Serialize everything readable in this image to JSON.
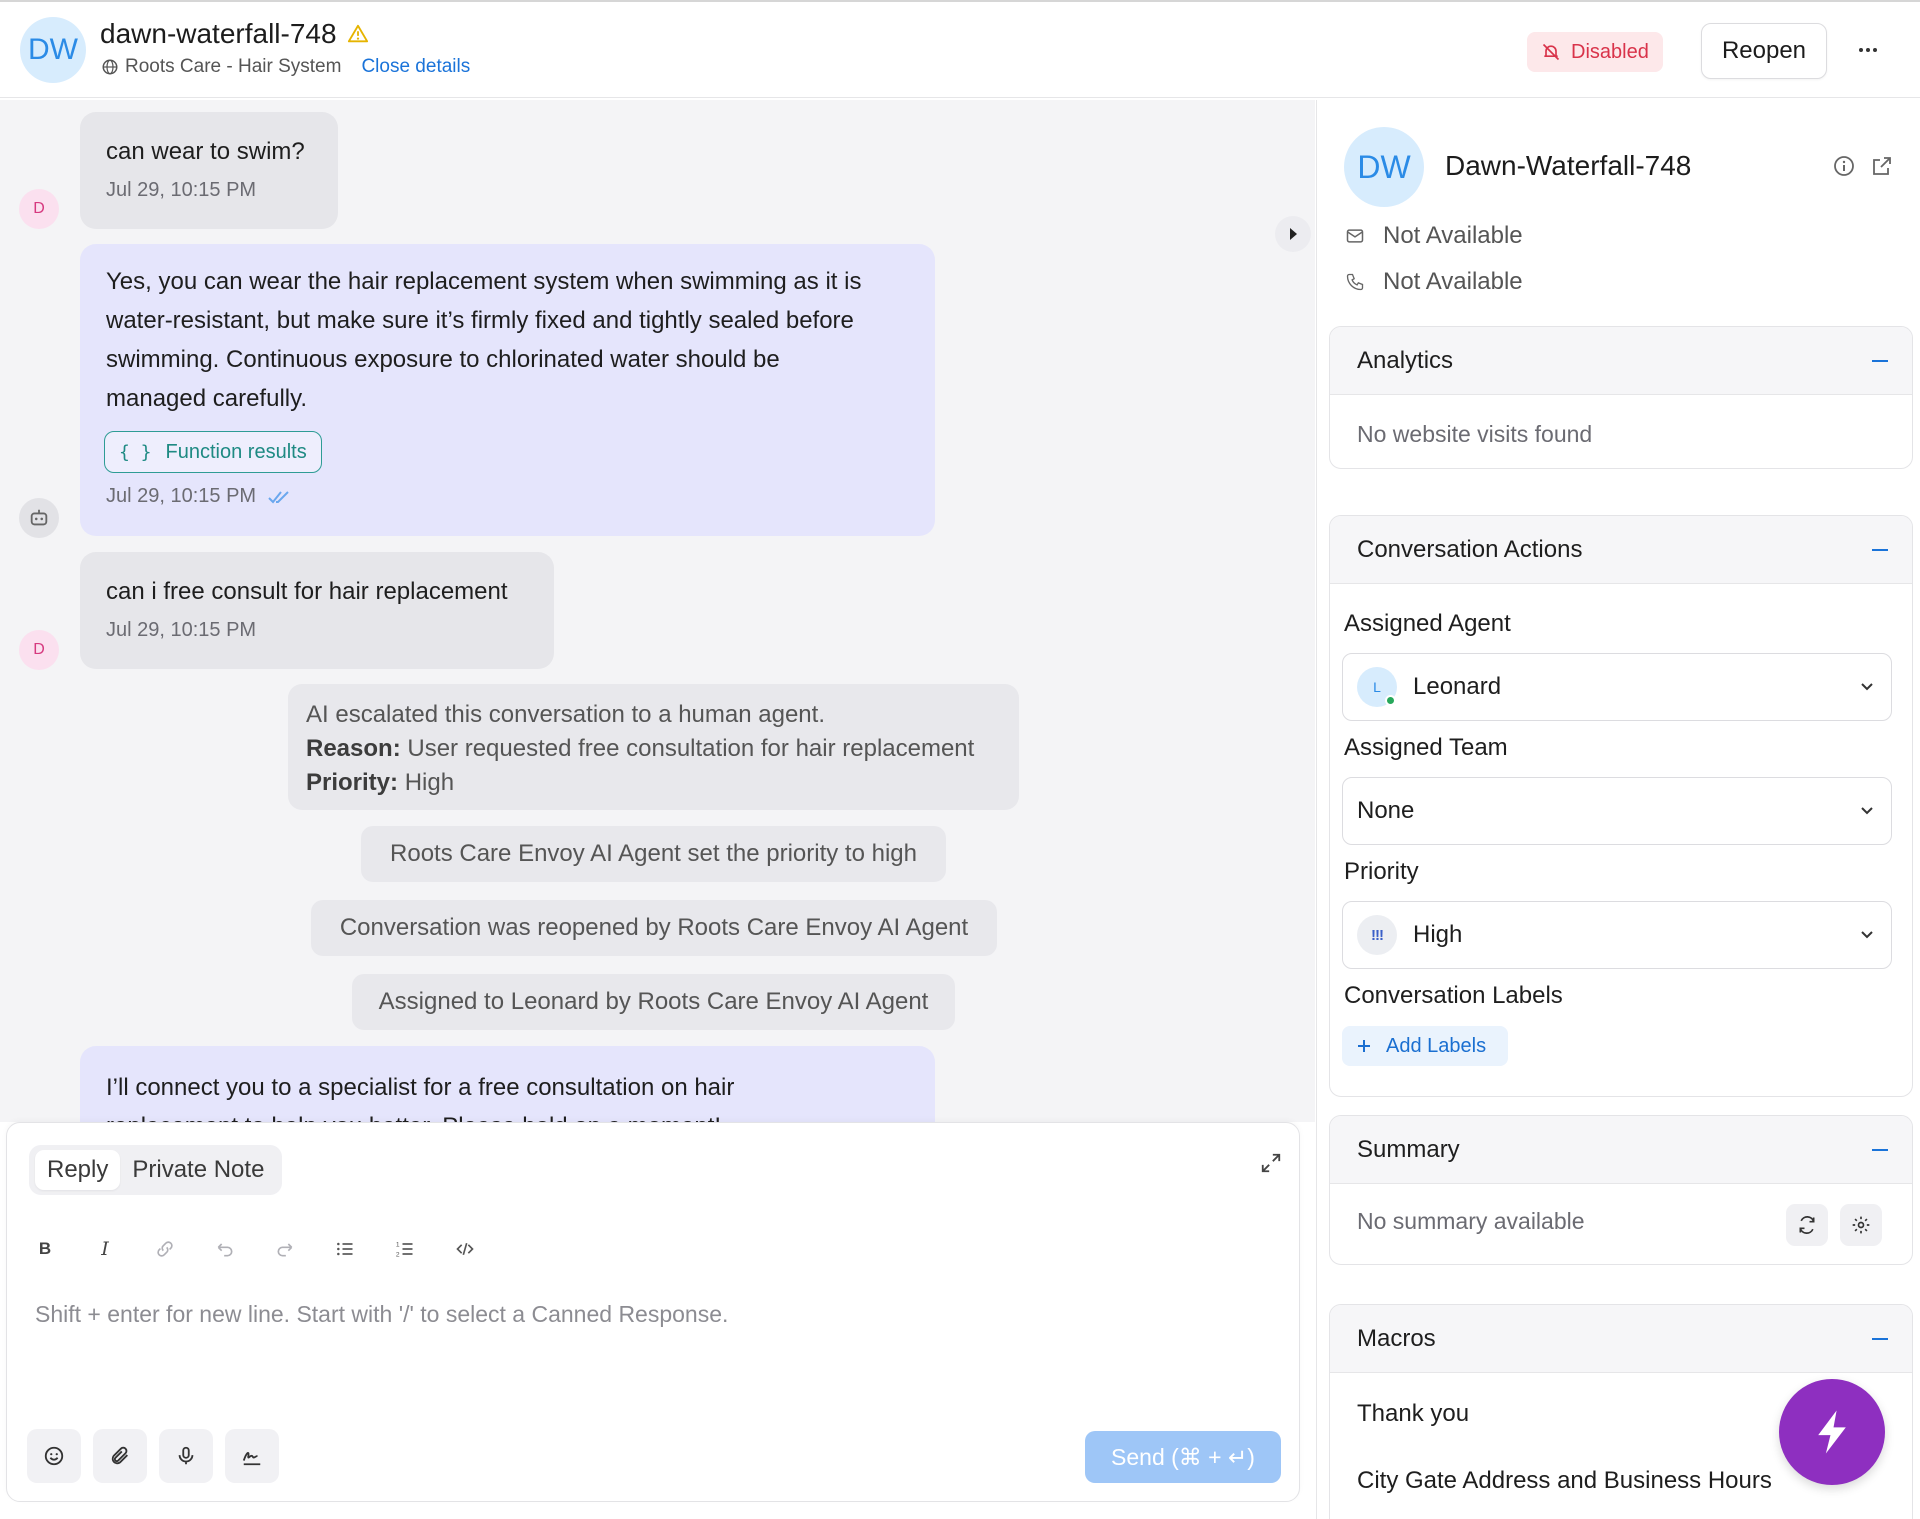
{
  "header": {
    "avatar_initials": "DW",
    "title": "dawn-waterfall-748",
    "inbox_name": "Roots Care - Hair System",
    "close_details": "Close details",
    "status_badge": "Disabled",
    "reopen_label": "Reopen"
  },
  "messages": [
    {
      "type": "incoming",
      "sender_initial": "D",
      "text": "can wear to swim?",
      "time": "Jul 29, 10:15 PM"
    },
    {
      "type": "outgoing",
      "lines": [
        "Yes, you can wear the hair replacement system when swimming as it is",
        "water-resistant, but make sure it’s firmly fixed and tightly sealed before",
        "swimming. Continuous exposure to chlorinated water should be",
        "managed carefully."
      ],
      "function_pill": "Function results",
      "time": "Jul 29, 10:15 PM"
    },
    {
      "type": "incoming",
      "sender_initial": "D",
      "text": "can i free consult for hair replacement",
      "time": "Jul 29, 10:15 PM"
    },
    {
      "type": "outgoing",
      "lines": [
        "I’ll connect you to a specialist for a free consultation on hair",
        "replacement to help you better. Please hold on a moment!"
      ]
    }
  ],
  "escalation": {
    "line1": "AI escalated this conversation to a human agent.",
    "reason_label": "Reason:",
    "reason_value": "User requested free consultation for hair replacement",
    "priority_label": "Priority:",
    "priority_value": "High"
  },
  "activities": [
    "Roots Care Envoy AI Agent set the priority to high",
    "Conversation was reopened by Roots Care Envoy AI Agent",
    "Assigned to Leonard by Roots Care Envoy AI Agent"
  ],
  "composer": {
    "tab_reply": "Reply",
    "tab_note": "Private Note",
    "placeholder": "Shift + enter for new line. Start with '/' to select a Canned Response.",
    "send_label": "Send (⌘ + ↵)"
  },
  "contact": {
    "initials": "DW",
    "name": "Dawn-Waterfall-748",
    "email": "Not Available",
    "phone": "Not Available"
  },
  "analytics": {
    "title": "Analytics",
    "empty": "No website visits found"
  },
  "actions": {
    "title": "Conversation Actions",
    "agent_label": "Assigned Agent",
    "agent_initial": "L",
    "agent_value": "Leonard",
    "team_label": "Assigned Team",
    "team_value": "None",
    "priority_label": "Priority",
    "priority_icon": "!!!",
    "priority_value": "High",
    "labels_label": "Conversation Labels",
    "add_labels": "Add Labels"
  },
  "summary": {
    "title": "Summary",
    "empty": "No summary available"
  },
  "macros": {
    "title": "Macros",
    "items": [
      "Thank you",
      "City Gate Address and Business Hours"
    ]
  },
  "colors": {
    "accent": "#1a73d9",
    "outgoing_bg": "#e5e5fc",
    "incoming_bg": "#e6e6ea",
    "fab": "#8e2fc0",
    "danger": "#d9334a"
  }
}
